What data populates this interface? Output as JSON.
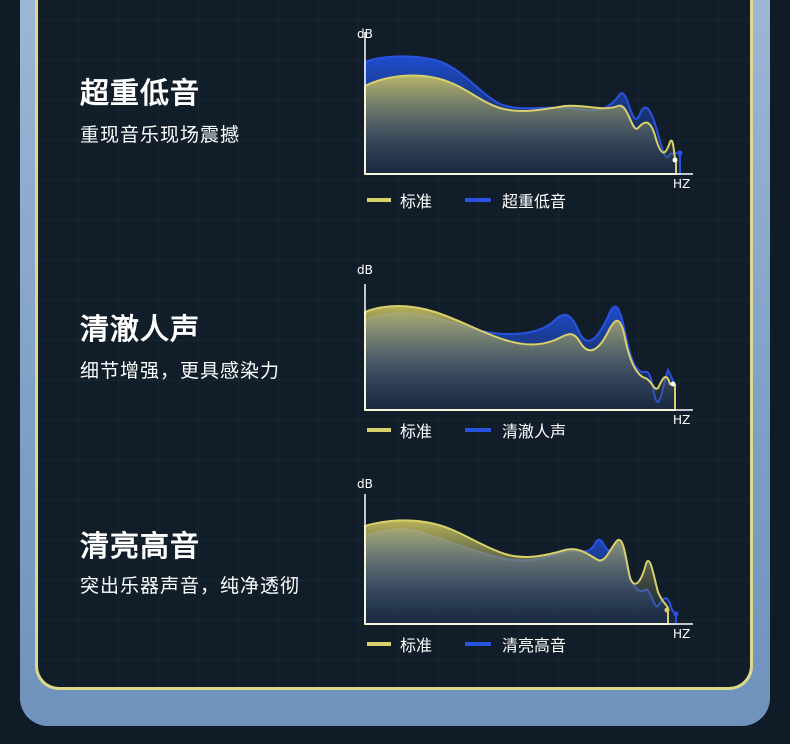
{
  "sections": [
    {
      "title": "超重低音",
      "subtitle": "重现音乐现场震撼",
      "chart": {
        "y_label": "dB",
        "x_label": "HZ",
        "legend_standard": "标准",
        "legend_mode": "超重低音"
      }
    },
    {
      "title": "清澈人声",
      "subtitle": "细节增强，更具感染力",
      "chart": {
        "y_label": "dB",
        "x_label": "HZ",
        "legend_standard": "标准",
        "legend_mode": "清澈人声"
      }
    },
    {
      "title": "清亮高音",
      "subtitle": "突出乐器声音，纯净透彻",
      "chart": {
        "y_label": "dB",
        "x_label": "HZ",
        "legend_standard": "标准",
        "legend_mode": "清亮高音"
      }
    }
  ],
  "colors": {
    "standard": "#d8d06a",
    "mode": "#2a52e0",
    "frame": "#dcd98a",
    "background": "#111d29"
  }
}
